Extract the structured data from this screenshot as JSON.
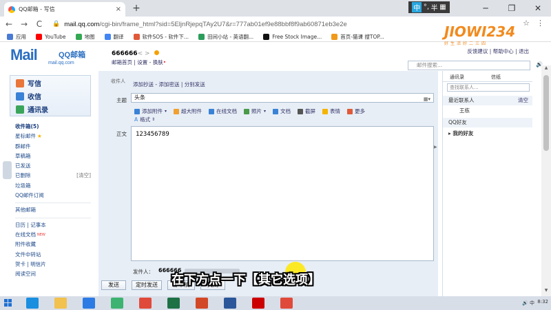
{
  "browser": {
    "tab_title": "QQ邮箱 - 写信",
    "tab_close": "×",
    "new_tab": "+",
    "url_domain": "mail.qq.com",
    "url_rest": "/cgi-bin/frame_html?sid=5EljnRjepqTAy2U7&r=777ab01ef9e88bbf8f9ab60871eb3e2e",
    "ime": {
      "zh": "中",
      "dot": "°,",
      "half": "半",
      "grid": "▦"
    },
    "window_controls": {
      "minimize": "─",
      "maximize": "❐",
      "close": "✕"
    },
    "nav": {
      "back": "←",
      "forward": "→",
      "reload": "C"
    },
    "toolbar_icons": {
      "star": "☆",
      "menu": "⋮"
    }
  },
  "bookmarks": [
    {
      "label": "应用",
      "color": "#4a7bd4"
    },
    {
      "label": "YouTube",
      "color": "#ff0000"
    },
    {
      "label": "地图",
      "color": "#34a853"
    },
    {
      "label": "翻译",
      "color": "#4285f4"
    },
    {
      "label": "软件SOS - 软件下...",
      "color": "#e05a3a"
    },
    {
      "label": "田间小站 - 英语翻...",
      "color": "#2a9d5a"
    },
    {
      "label": "Free Stock Image...",
      "color": "#111111"
    },
    {
      "label": "首页-猫课 搜TOP...",
      "color": "#f09a1a"
    }
  ],
  "mail_header": {
    "logo_m": "M",
    "logo_ail": "ail",
    "logo_title": "QQ邮箱",
    "logo_sub": "mail.qq.com",
    "user_name": "666666",
    "user_email_masked": "<              >",
    "links_left": [
      "邮箱首页",
      "设置",
      "换肤"
    ],
    "links_right": [
      "反馈建议",
      "帮助中心",
      "退出"
    ],
    "search_placeholder": "邮件搜索..."
  },
  "watermark": {
    "text": "好生活好二三四",
    "big": "JIOWI234"
  },
  "leftnav": {
    "primary": [
      {
        "label": "写信",
        "color": "#e9763a"
      },
      {
        "label": "收信",
        "color": "#3a82d6"
      },
      {
        "label": "通讯录",
        "color": "#3aa55a"
      }
    ],
    "folders": [
      {
        "label": "收件箱(5)",
        "bold": true
      },
      {
        "label": "星标邮件",
        "star": "★"
      },
      {
        "label": "群邮件"
      },
      {
        "label": "草稿箱"
      },
      {
        "label": "已发送"
      },
      {
        "label": "已删除",
        "right": "[清空]"
      },
      {
        "label": "垃圾箱"
      },
      {
        "label": "QQ邮件订阅"
      }
    ],
    "folders2": [
      {
        "label": "其他邮箱"
      }
    ],
    "apps": [
      {
        "label": "日历 | 记事本"
      },
      {
        "label": "在线文档",
        "new": "NEW"
      },
      {
        "label": "附件收藏"
      },
      {
        "label": "文件中转站"
      },
      {
        "label": "贺卡 | 明信片"
      },
      {
        "label": "阅读空间"
      }
    ]
  },
  "compose": {
    "recipient_label": "收件人",
    "add_links": "添加抄送 - 添加密送 | 分别发送",
    "subject_label": "主题",
    "subject_value": "头条",
    "toolbar": [
      {
        "label": "添加附件",
        "color": "#3a82d6",
        "sub": "▾"
      },
      {
        "label": "超大附件",
        "color": "#f0a030"
      },
      {
        "label": "在线文档",
        "color": "#3a82d6"
      },
      {
        "label": "照片",
        "color": "#4a9a4a",
        "sub": "▾"
      },
      {
        "label": "文档",
        "color": "#3a82d6"
      },
      {
        "label": "截屏",
        "color": "#555555"
      },
      {
        "label": "表情",
        "color": "#f5b400"
      },
      {
        "label": "更多",
        "color": "#e05a3a"
      }
    ],
    "format_label": "格式",
    "body_label": "正文",
    "body_text": "123456789",
    "sender_label": "发件人：",
    "sender_value": "666666",
    "buttons": [
      "发送",
      "定时发送",
      "存草稿",
      "关闭"
    ]
  },
  "rightpanel": {
    "tabs": [
      "通讯录",
      "信纸"
    ],
    "search_placeholder": "查找联系人...",
    "recent_label": "最近联系人",
    "recent_clear": "清空",
    "recent_item": "王栋",
    "qq_friends": "QQ好友",
    "my_friends": "我的好友"
  },
  "caption": "在下方点一下【其它选项】",
  "taskbar": {
    "apps": [
      {
        "name": "ie",
        "color": "#1a8fe0"
      },
      {
        "name": "explorer",
        "color": "#f2c14e"
      },
      {
        "name": "baidu",
        "color": "#2c7be5"
      },
      {
        "name": "edge",
        "color": "#3cb371"
      },
      {
        "name": "chrome",
        "color": "#e04a3a"
      },
      {
        "name": "excel",
        "color": "#1e7145"
      },
      {
        "name": "powerpoint",
        "color": "#d24726"
      },
      {
        "name": "word",
        "color": "#2b579a"
      },
      {
        "name": "recorder",
        "color": "#cc0000"
      },
      {
        "name": "chrome2",
        "color": "#e04a3a"
      }
    ],
    "tray": "🔊 中",
    "time": "8:32"
  }
}
